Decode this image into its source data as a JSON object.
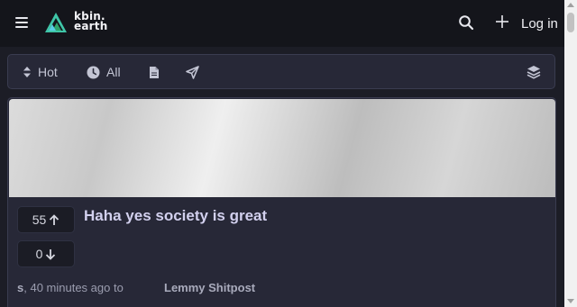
{
  "header": {
    "brand_line1": "kbin.",
    "brand_line2": "earth",
    "login_label": "Log in"
  },
  "icons": {
    "menu": "hamburger-icon",
    "logo": "kbin-logo-icon",
    "search": "search-icon",
    "add": "plus-icon",
    "sort": "sort-icon",
    "clock": "clock-icon",
    "document": "document-icon",
    "link": "link-icon",
    "layers": "layers-icon",
    "upvote": "arrow-up-icon",
    "downvote": "arrow-down-icon"
  },
  "filters": {
    "sort_label": "Hot",
    "time_label": "All"
  },
  "post": {
    "title": "Haha yes society is great",
    "upvotes": "55",
    "downvotes": "0",
    "author": "s",
    "time_text": ", 40 minutes ago to",
    "magazine": "Lemmy Shitpost"
  },
  "colors": {
    "background": "#1c1d26",
    "topbar": "#14151b",
    "panel": "#272837",
    "title": "#d2d0ee",
    "logo_teal": "#3fc6a8",
    "logo_green": "#2ea36b"
  }
}
